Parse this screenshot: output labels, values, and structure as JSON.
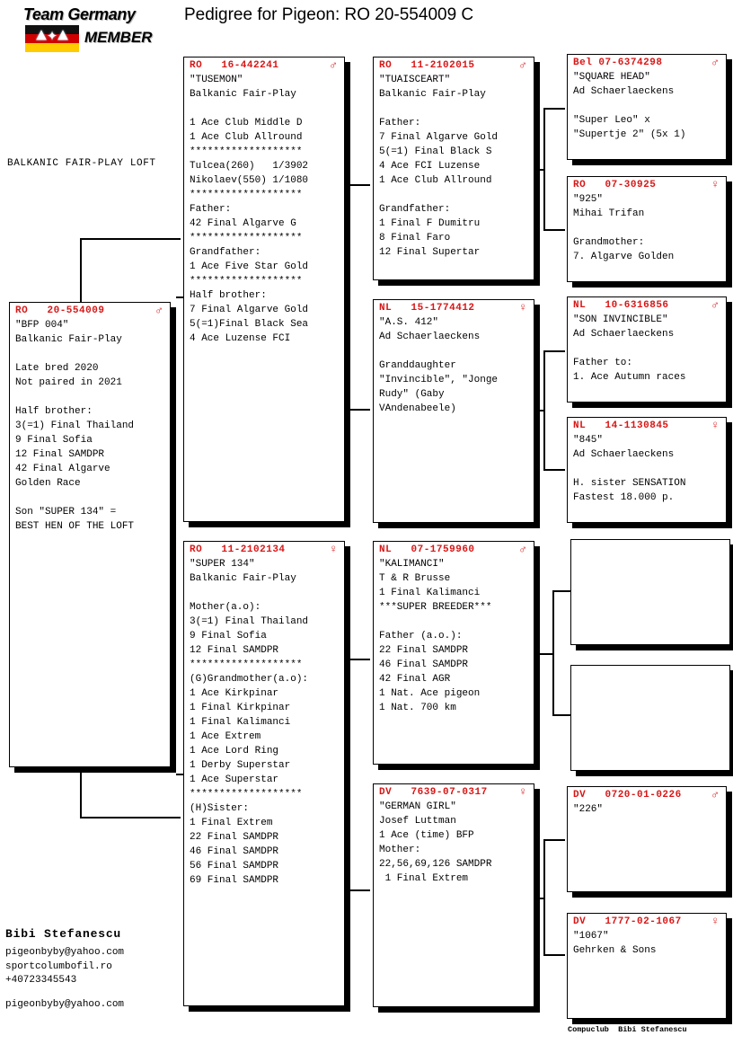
{
  "header": {
    "logo_team": "Team Germany",
    "logo_member": "MEMBER",
    "title": "Pedigree for Pigeon: RO  20-554009 C"
  },
  "loft": {
    "name": "BALKANIC FAIR-PLAY LOFT"
  },
  "footer": {
    "owner": "Bibi Stefanescu",
    "email": "pigeonbyby@yahoo.com",
    "website": "sportcolumbofil.ro",
    "phone": "+40723345543",
    "email2": "pigeonbyby@yahoo.com",
    "copyright": "Compuclub \u0001 Bibi Stefanescu"
  },
  "symbols": {
    "male": "♂",
    "female": "♀"
  },
  "colors": {
    "ring_red": "#d81616",
    "text_black": "#000000",
    "card_bg": "#ffffff",
    "shadow": "#000000"
  },
  "cards": {
    "subject": {
      "ring": "RO   20-554009",
      "sex": "male",
      "name": "\"BFP 004\"",
      "body": "\"BFP 004\"\nBalkanic Fair-Play\n\nLate bred 2020\nNot paired in 2021\n\nHalf brother:\n3(=1) Final Thailand\n9 Final Sofia\n12 Final SAMDPR\n42 Final Algarve\nGolden Race\n\nSon \"SUPER 134\" =\nBEST HEN OF THE LOFT"
    },
    "father": {
      "ring": "RO   16-442241",
      "sex": "male",
      "name": "\"TUSEMON\"",
      "body": "\"TUSEMON\"\nBalkanic Fair-Play\n\n1 Ace Club Middle D\n1 Ace Club Allround\n*******************\nTulcea(260)   1/3902\nNikolaev(550) 1/1080\n*******************\nFather:\n42 Final Algarve G\n*******************\nGrandfather:\n1 Ace Five Star Gold\n*******************\nHalf brother:\n7 Final Algarve Gold\n5(=1)Final Black Sea\n4 Ace Luzense FCI"
    },
    "mother": {
      "ring": "RO   11-2102134",
      "sex": "female",
      "name": "\"SUPER 134\"",
      "body": "\"SUPER 134\"\nBalkanic Fair-Play\n\nMother(a.o):\n3(=1) Final Thailand\n9 Final Sofia\n12 Final SAMDPR\n*******************\n(G)Grandmother(a.o):\n1 Ace Kirkpinar\n1 Final Kirkpinar\n1 Final Kalimanci\n1 Ace Extrem\n1 Ace Lord Ring\n1 Derby Superstar\n1 Ace Superstar\n*******************\n(H)Sister:\n1 Final Extrem\n22 Final SAMDPR\n46 Final SAMDPR\n56 Final SAMDPR\n69 Final SAMDPR"
    },
    "gf_paternal": {
      "ring": "RO   11-2102015",
      "sex": "male",
      "name": "\"TUAISCEART\"",
      "body": "\"TUAISCEART\"\nBalkanic Fair-Play\n\nFather:\n7 Final Algarve Gold\n5(=1) Final Black S\n4 Ace FCI Luzense\n1 Ace Club Allround\n\nGrandfather:\n1 Final F Dumitru\n8 Final Faro\n12 Final Supertar"
    },
    "gm_paternal": {
      "ring": "NL   15-1774412",
      "sex": "female",
      "name": "\"A.S. 412\"",
      "body": "\"A.S. 412\"\nAd Schaerlaeckens\n\nGranddaughter\n\"Invincible\", \"Jonge\nRudy\" (Gaby\nVAndenabeele)"
    },
    "gf_maternal": {
      "ring": "NL   07-1759960",
      "sex": "male",
      "name": "\"KALIMANCI\"",
      "body": "\"KALIMANCI\"\nT & R Brusse\n1 Final Kalimanci\n***SUPER BREEDER***\n\nFather (a.o.):\n22 Final SAMDPR\n46 Final SAMDPR\n42 Final AGR\n1 Nat. Ace pigeon\n1 Nat. 700 km"
    },
    "gm_maternal": {
      "ring": "DV   7639-07-0317",
      "sex": "female",
      "name": "\"GERMAN GIRL\"",
      "body": "\"GERMAN GIRL\"\nJosef Luttman\n1 Ace (time) BFP\nMother:\n22,56,69,126 SAMDPR\n 1 Final Extrem"
    },
    "ggf1": {
      "ring": "Bel 07-6374298",
      "sex": "male",
      "name": "\"SQUARE HEAD\"",
      "body": "\"SQUARE HEAD\"\nAd Schaerlaeckens\n\n\"Super Leo\" x\n\"Supertje 2\" (5x 1)"
    },
    "ggm1": {
      "ring": "RO   07-30925",
      "sex": "female",
      "name": "\"925\"",
      "body": "\"925\"\nMihai Trifan\n\nGrandmother:\n7. Algarve Golden"
    },
    "ggf2": {
      "ring": "NL   10-6316856",
      "sex": "male",
      "name": "\"SON INVINCIBLE\"",
      "body": "\"SON INVINCIBLE\"\nAd Schaerlaeckens\n\nFather to:\n1. Ace Autumn races"
    },
    "ggm2": {
      "ring": "NL   14-1130845",
      "sex": "female",
      "name": "\"845\"",
      "body": "\"845\"\nAd Schaerlaeckens\n\nH. sister SENSATION\nFastest 18.000 p."
    },
    "ggf3": {
      "ring": "",
      "sex": "",
      "name": "",
      "body": ""
    },
    "ggm3": {
      "ring": "",
      "sex": "",
      "name": "",
      "body": ""
    },
    "ggf4": {
      "ring": "DV   0720-01-0226",
      "sex": "male",
      "name": "\"226\"",
      "body": "\"226\""
    },
    "ggm4": {
      "ring": "DV   1777-02-1067",
      "sex": "female",
      "name": "\"1067\"",
      "body": "\"1067\"\nGehrken & Sons"
    }
  }
}
